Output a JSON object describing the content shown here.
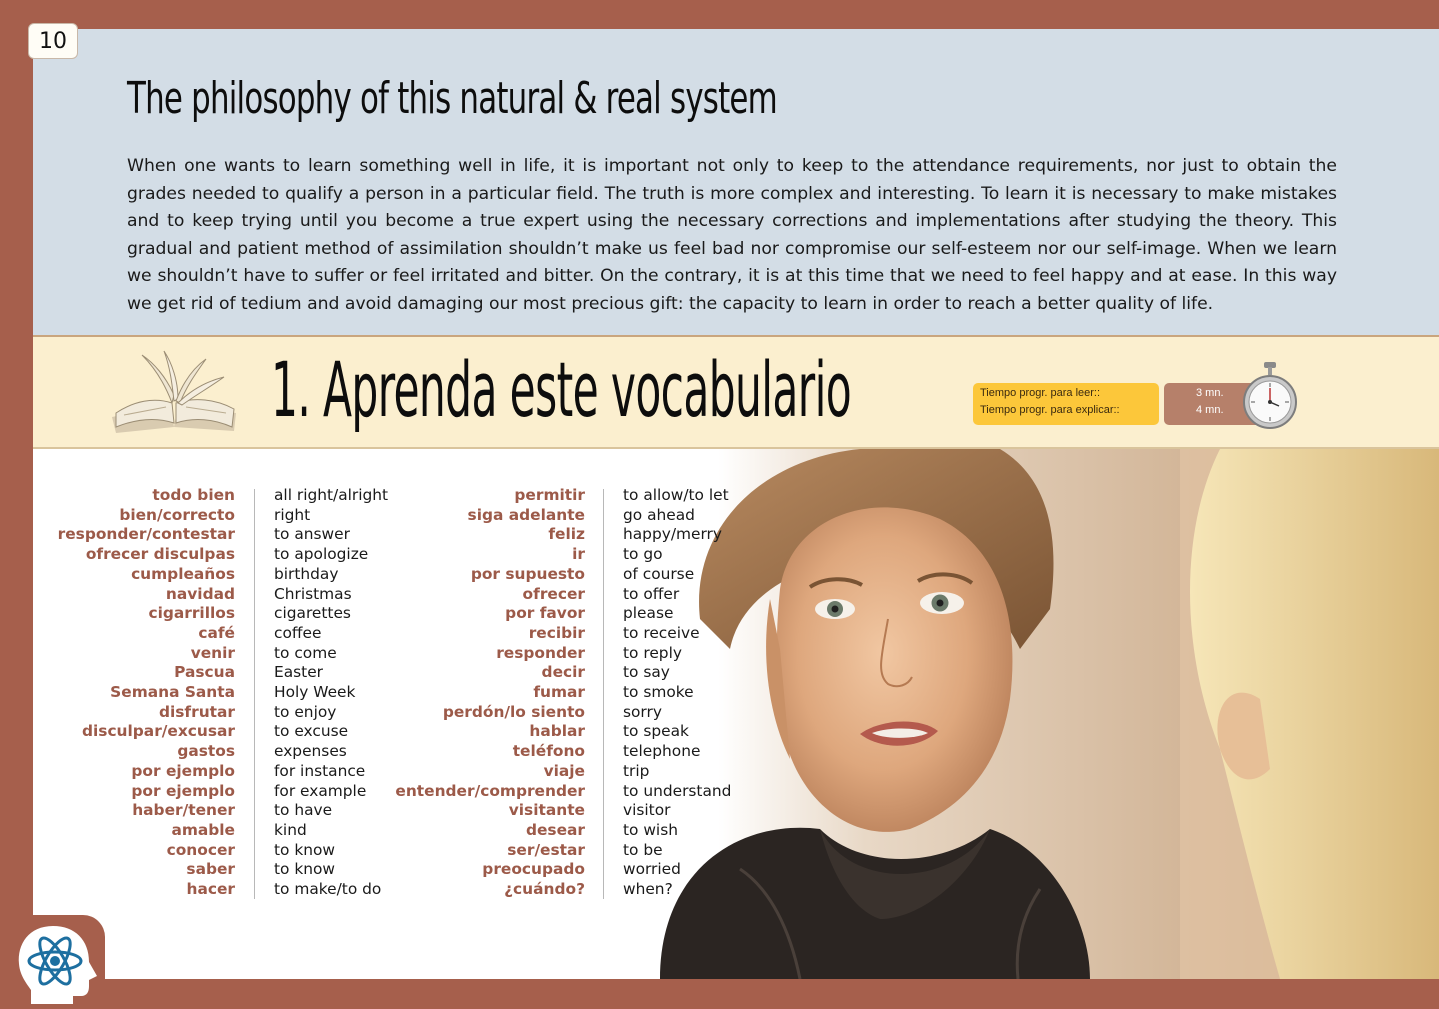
{
  "page": {
    "number": "10"
  },
  "intro": {
    "title": "The philosophy of this natural & real system",
    "body": "When one wants to learn something well in life, it is important not only to keep to the attendance requirements, nor just to obtain the grades needed to qualify a person in a particular field. The truth is more complex and interesting. To learn it is necessary to make mistakes and to keep trying until you become a true expert using the necessary corrections and implementations after studying the theory. This gradual and patient method of assimilation shouldn’t make us feel bad nor compromise our self-esteem nor our self-image. When we learn we shouldn’t have to suffer or feel irritated and bitter. On the contrary, it is at this time that we need to feel happy and at ease. In this way we get rid of tedium and avoid damaging our most precious gift: the capacity to learn in order to reach a better quality of life."
  },
  "section": {
    "title": "1. Aprenda este vocabulario",
    "timing": {
      "read_label": "Tiempo progr. para leer::",
      "explain_label": "Tiempo progr. para explicar::",
      "read_value": "3 mn.",
      "explain_value": "4 mn."
    }
  },
  "vocab": {
    "col1_es": [
      "todo bien",
      "bien/correcto",
      "responder/contestar",
      "ofrecer disculpas",
      "cumpleaños",
      "navidad",
      "cigarrillos",
      "café",
      "venir",
      "Pascua",
      "Semana Santa",
      "disfrutar",
      "disculpar/excusar",
      "gastos",
      "por ejemplo",
      "por ejemplo",
      "haber/tener",
      "amable",
      "conocer",
      "saber",
      "hacer"
    ],
    "col1_en": [
      "all right/alright",
      "right",
      "to answer",
      "to apologize",
      "birthday",
      "Christmas",
      "cigarettes",
      "coffee",
      "to come",
      "Easter",
      "Holy Week",
      "to enjoy",
      "to excuse",
      "expenses",
      "for instance",
      "for example",
      "to have",
      "kind",
      "to know",
      "to know",
      "to make/to do"
    ],
    "col2_es": [
      "permitir",
      "siga adelante",
      "feliz",
      "ir",
      "por supuesto",
      "ofrecer",
      "por favor",
      "recibir",
      "responder",
      "decir",
      "fumar",
      "perdón/lo siento",
      "hablar",
      "teléfono",
      "viaje",
      "entender/comprender",
      "visitante",
      "desear",
      "ser/estar",
      "preocupado",
      "¿cuándo?"
    ],
    "col2_en": [
      "to allow/to let",
      "go ahead",
      "happy/merry",
      "to go",
      "of course",
      "to offer",
      "please",
      "to receive",
      "to reply",
      "to say",
      "to smoke",
      "sorry",
      "to speak",
      "telephone",
      "trip",
      "to understand",
      "visitor",
      "to wish",
      "to be",
      "worried",
      "when?"
    ]
  },
  "colors": {
    "frame": "#a65f4c",
    "intro_bg": "#d3dde6",
    "band_bg": "#fbefcf",
    "spanish_word": "#9c5a49",
    "timing_box": "#fcc73a",
    "timing_values_box": "#b6806a"
  },
  "icons": [
    "open-book-icon",
    "stopwatch-icon",
    "atom-head-icon"
  ]
}
